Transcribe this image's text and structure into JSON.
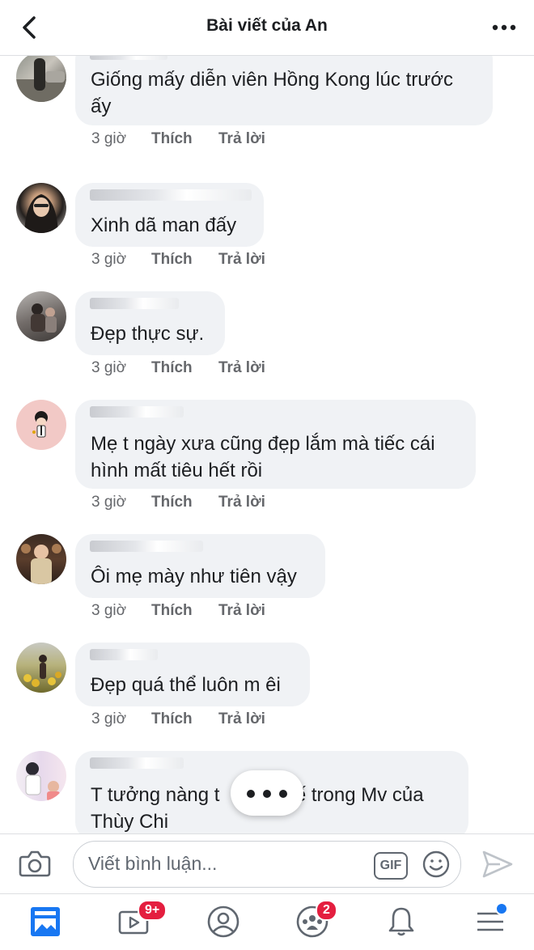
{
  "header": {
    "title": "Bài viết của An"
  },
  "comments": [
    {
      "text_lines": [
        "Giống mấy diễn viên Hồng Kong lúc trước",
        "ấy"
      ],
      "time": "3 giờ",
      "like": "Thích",
      "reply": "Trả lời"
    },
    {
      "text_lines": [
        "Xinh dã man đấy"
      ],
      "time": "3 giờ",
      "like": "Thích",
      "reply": "Trả lời"
    },
    {
      "text_lines": [
        "Đẹp thực sự."
      ],
      "time": "3 giờ",
      "like": "Thích",
      "reply": "Trả lời"
    },
    {
      "text_lines": [
        "Mẹ t ngày xưa cũng đẹp lắm mà tiếc cái",
        "hình mất tiêu hết rồi"
      ],
      "time": "3 giờ",
      "like": "Thích",
      "reply": "Trả lời"
    },
    {
      "text_lines": [
        "Ôi mẹ mày như tiên vậy"
      ],
      "time": "3 giờ",
      "like": "Thích",
      "reply": "Trả lời"
    },
    {
      "text_lines": [
        "Đẹp quá thể luôn m êi"
      ],
      "time": "3 giờ",
      "like": "Thích",
      "reply": "Trả lời"
    },
    {
      "text_lines": [
        "T tưởng nàng t",
        "Thùy Chi"
      ],
      "text_line1_tail": "uế trong Mv của"
    }
  ],
  "composer": {
    "placeholder": "Viết bình luận...",
    "gif_label": "GIF"
  },
  "tabbar": {
    "watch_badge": "9+",
    "groups_badge": "2"
  },
  "icons": [
    "back-arrow-icon",
    "more-icon",
    "camera-icon",
    "gif-icon",
    "emoji-icon",
    "send-icon",
    "news-feed-icon",
    "watch-icon",
    "profile-icon",
    "groups-icon",
    "notifications-icon",
    "menu-icon"
  ],
  "colors": {
    "accent": "#1877f2",
    "badge": "#e41e3f",
    "bubble": "#f0f2f5"
  }
}
